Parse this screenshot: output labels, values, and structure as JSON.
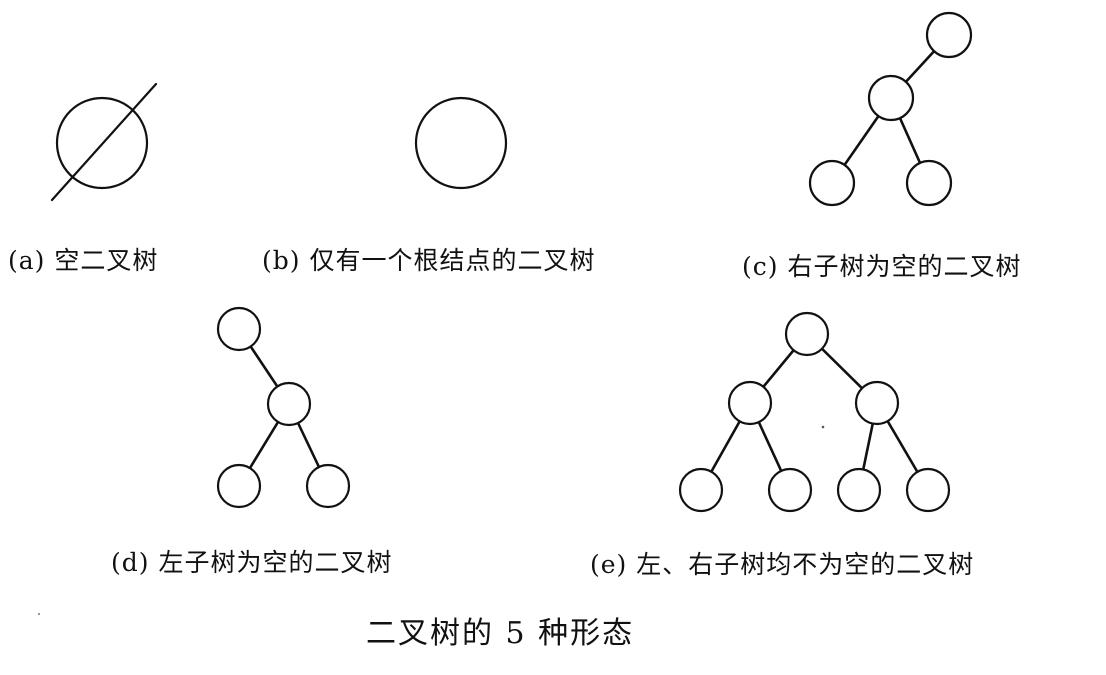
{
  "figure": {
    "title": "二叉树的 5 种形态",
    "panels": [
      {
        "id": "a",
        "caption": "(a) 空二叉树",
        "shape": "empty-tree"
      },
      {
        "id": "b",
        "caption": "(b) 仅有一个根结点的二叉树",
        "shape": "root-only"
      },
      {
        "id": "c",
        "caption": "(c) 右子树为空的二叉树",
        "shape": "right-subtree-empty"
      },
      {
        "id": "d",
        "caption": "(d) 左子树为空的二叉树",
        "shape": "left-subtree-empty"
      },
      {
        "id": "e",
        "caption": "(e) 左、右子树均不为空的二叉树",
        "shape": "both-subtrees-nonempty"
      }
    ]
  }
}
